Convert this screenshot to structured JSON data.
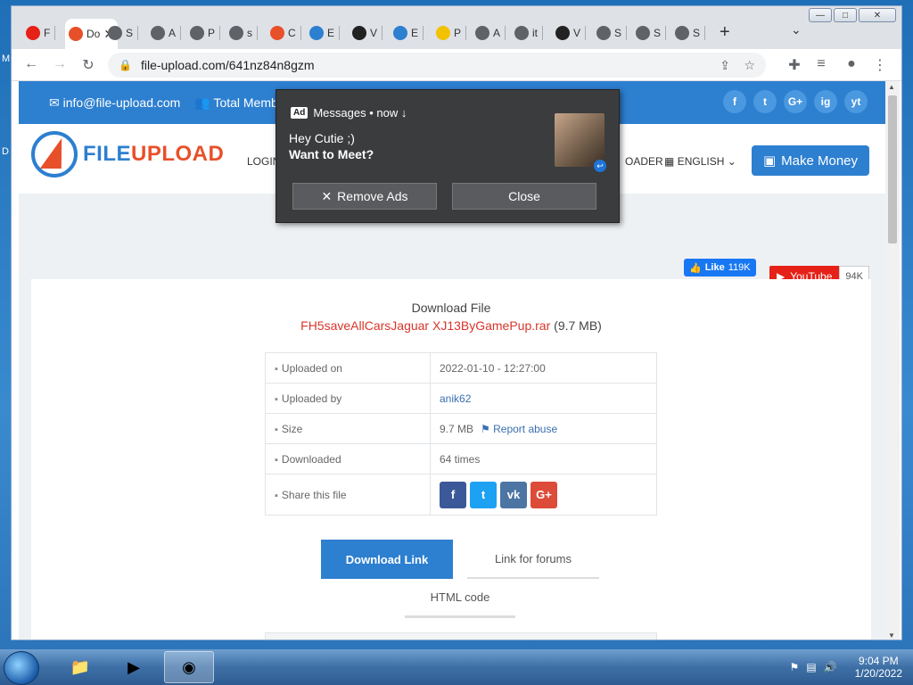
{
  "desktop": {
    "left_letters": [
      "M",
      "D"
    ]
  },
  "window": {
    "minimize": "—",
    "maximize": "□",
    "close": "✕"
  },
  "tabs": [
    {
      "label": "F",
      "icon": "youtube-icon",
      "color": "#e62117"
    },
    {
      "label": "Do",
      "icon": "fileupload-icon",
      "color": "#e8502a",
      "active": true
    },
    {
      "label": "S",
      "icon": "globe-icon",
      "color": "#5f6368"
    },
    {
      "label": "A",
      "icon": "globe-icon",
      "color": "#5f6368"
    },
    {
      "label": "P",
      "icon": "globe-icon",
      "color": "#5f6368"
    },
    {
      "label": "s",
      "icon": "globe-icon",
      "color": "#5f6368"
    },
    {
      "label": "C",
      "icon": "c-icon",
      "color": "#e8502a"
    },
    {
      "label": "E",
      "icon": "s-icon",
      "color": "#2d7fd0"
    },
    {
      "label": "V",
      "icon": "wave-icon",
      "color": "#222222"
    },
    {
      "label": "E",
      "icon": "s-icon",
      "color": "#2d7fd0"
    },
    {
      "label": "P",
      "icon": "smile-icon",
      "color": "#f2c200"
    },
    {
      "label": "A",
      "icon": "globe-icon",
      "color": "#5f6368"
    },
    {
      "label": "it",
      "icon": "globe-icon",
      "color": "#5f6368"
    },
    {
      "label": "V",
      "icon": "wave-icon",
      "color": "#222222"
    },
    {
      "label": "S",
      "icon": "globe-icon",
      "color": "#5f6368"
    },
    {
      "label": "S",
      "icon": "globe-icon",
      "color": "#5f6368"
    },
    {
      "label": "S",
      "icon": "globe-icon",
      "color": "#5f6368"
    }
  ],
  "toolbar": {
    "url": "file-upload.com/641nz84n8gzm"
  },
  "site": {
    "email": "info@file-upload.com",
    "members": "Total Membe",
    "socials": [
      "f",
      "t",
      "G+",
      "ig",
      "yt"
    ],
    "logo_a": "FILE",
    "logo_b": "UPLOAD",
    "nav_login": "LOGIN",
    "nav_loader": "OADER",
    "nav_lang": "ENGLISH",
    "make_money": "Make Money",
    "fb_like": "Like",
    "fb_count": "119K",
    "yt_label": "YouTube",
    "yt_count": "94K"
  },
  "download": {
    "title": "Download File",
    "filename": "FH5saveAllCarsJaguar XJ13ByGamePup.rar",
    "size_paren": "(9.7 MB)",
    "rows": [
      {
        "label": "Uploaded on",
        "icon": "calendar-icon",
        "value": "2022-01-10 - 12:27:00"
      },
      {
        "label": "Uploaded by",
        "icon": "user-icon",
        "value": "anik62"
      },
      {
        "label": "Size",
        "icon": "drive-icon",
        "value": "9.7 MB",
        "extra": "Report abuse"
      },
      {
        "label": "Downloaded",
        "icon": "download-icon",
        "value": "64 times"
      },
      {
        "label": "Share this file",
        "icon": "share-icon"
      }
    ],
    "share": [
      {
        "label": "f",
        "color": "#3b5998"
      },
      {
        "label": "t",
        "color": "#1da1f2"
      },
      {
        "label": "vk",
        "color": "#4c75a3"
      },
      {
        "label": "G+",
        "color": "#dd4b39"
      }
    ],
    "btn_download_link": "Download Link",
    "btn_forums": "Link for forums",
    "btn_html": "HTML code"
  },
  "popup": {
    "badge": "Ad",
    "header": "Messages • now ↓",
    "line1": "Hey Cutie ;)",
    "line2": "Want to Meet?",
    "remove_ads": "Remove Ads",
    "close": "Close"
  },
  "taskbar": {
    "time": "9:04 PM",
    "date": "1/20/2022"
  }
}
